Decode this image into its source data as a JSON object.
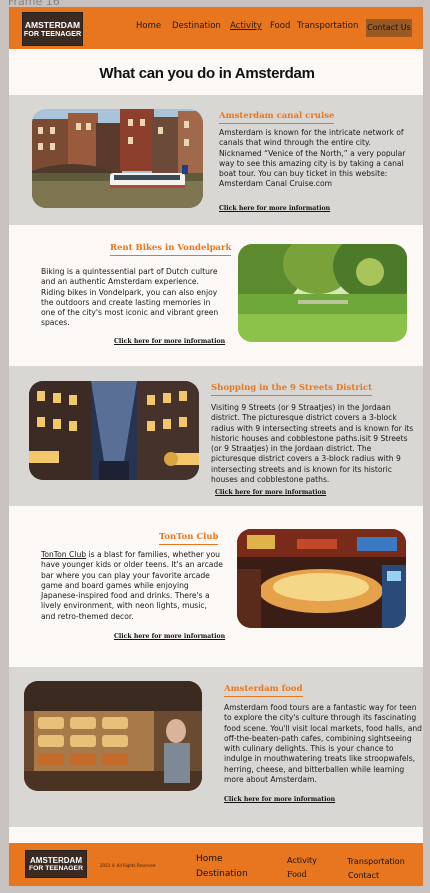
{
  "frame_label": "Frame 16",
  "header": {
    "logo": {
      "line1": "AMSTERDAM",
      "line2": "FOR TEENAGER"
    },
    "nav": [
      "Home",
      "Destination",
      "Activity",
      "Food",
      "Transportation"
    ],
    "contact": "Contact Us"
  },
  "page_title": "What can you do in Amsterdam",
  "sections": [
    {
      "heading": "Amsterdam canal cruise",
      "text": "Amsterdam is known for the intricate network of canals that wind through the entire city. Nicknamed “Venice of the North,” a very popular way to see this amazing city is by taking a canal boat tour. You can buy ticket in this website: Amsterdam Canal Cruise.com",
      "link": "Click here for more information"
    },
    {
      "heading": "Rent Bikes in Vondelpark",
      "text": "Biking is a quintessential part of Dutch culture and an authentic Amsterdam experience. Riding bikes in Vondelpark, you can also enjoy the outdoors and create lasting memories in one of the city's most iconic and vibrant green spaces.",
      "link": "Click here for more information"
    },
    {
      "heading": "Shopping in the 9 Streets District",
      "text": "Visiting 9 Streets (or 9 Straatjes) in the Jordaan district. The picturesque district covers a 3-block radius with 9 intersecting streets and is known for its historic houses and cobblestone paths.isit 9 Streets (or 9 Straatjes) in the Jordaan district. The picturesque district covers a 3-block radius with 9 intersecting streets and is known for its historic houses and cobblestone paths.",
      "link": "Click here for more information"
    },
    {
      "heading": "TonTon Club",
      "text_link": "TonTon Club",
      "text": " is a blast for families, whether you have younger kids or older teens. It's an arcade bar where you can play your favorite arcade game and board games while enjoying Japanese-inspired food and drinks. There's a lively environment, with neon lights, music, and retro-themed decor.",
      "link": "Click here for more information"
    },
    {
      "heading": "Amsterdam food",
      "text": "Amsterdam food tours are a fantastic way for teen to explore the city's culture through its fascinating food scene. You'll visit local markets, food halls, and off-the-beaten-path cafes, combining sightseeing with culinary delights. This is your chance to indulge in mouthwatering treats like stroopwafels, herring, cheese, and bitterballen while learning more about Amsterdam.",
      "link": "Click here for more information"
    }
  ],
  "footer": {
    "logo": {
      "line1": "AMSTERDAM",
      "line2": "FOR TEENAGER"
    },
    "copyright": "2023 © All Rights Reserved",
    "nav": [
      "Home",
      "Destination",
      "Activity",
      "Food",
      "Transportation",
      "Contact"
    ]
  },
  "colors": {
    "accent": "#e8761f",
    "gray_band": "#d9d7d4",
    "light_band": "#fbf8f6",
    "button": "#9b5a24"
  }
}
